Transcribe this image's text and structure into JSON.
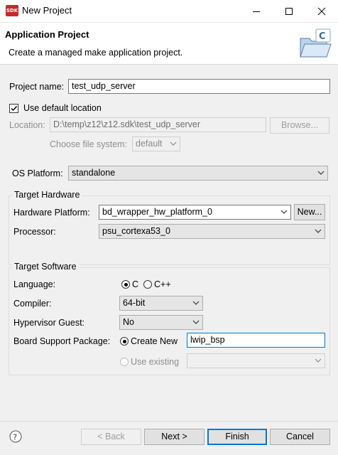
{
  "window": {
    "app_icon_text": "SDK",
    "title": "New Project"
  },
  "header": {
    "title": "Application Project",
    "description": "Create a managed make application project."
  },
  "project": {
    "name_label": "Project name:",
    "name_value": "test_udp_server",
    "use_default_label": "Use default location",
    "use_default_checked": true,
    "location_label": "Location:",
    "location_value": "D:\\temp\\z12\\z12.sdk\\test_udp_server",
    "browse_label": "Browse...",
    "filesystem_label": "Choose file system:",
    "filesystem_value": "default"
  },
  "os": {
    "label": "OS Platform:",
    "value": "standalone"
  },
  "target_hardware": {
    "title": "Target Hardware",
    "platform_label": "Hardware Platform:",
    "platform_value": "bd_wrapper_hw_platform_0",
    "new_button": "New...",
    "processor_label": "Processor:",
    "processor_value": "psu_cortexa53_0"
  },
  "target_software": {
    "title": "Target Software",
    "language_label": "Language:",
    "lang_c": "C",
    "lang_cpp": "C++",
    "selected_language": "C",
    "compiler_label": "Compiler:",
    "compiler_value": "64-bit",
    "hypervisor_label": "Hypervisor Guest:",
    "hypervisor_value": "No",
    "bsp_label": "Board Support Package:",
    "create_new_label": "Create New",
    "bsp_name_value": "lwip_bsp",
    "use_existing_label": "Use existing",
    "use_existing_value": ""
  },
  "footer": {
    "back": "< Back",
    "next": "Next >",
    "finish": "Finish",
    "cancel": "Cancel"
  },
  "colors": {
    "accent": "#0078d7",
    "icon_red": "#c82828"
  }
}
